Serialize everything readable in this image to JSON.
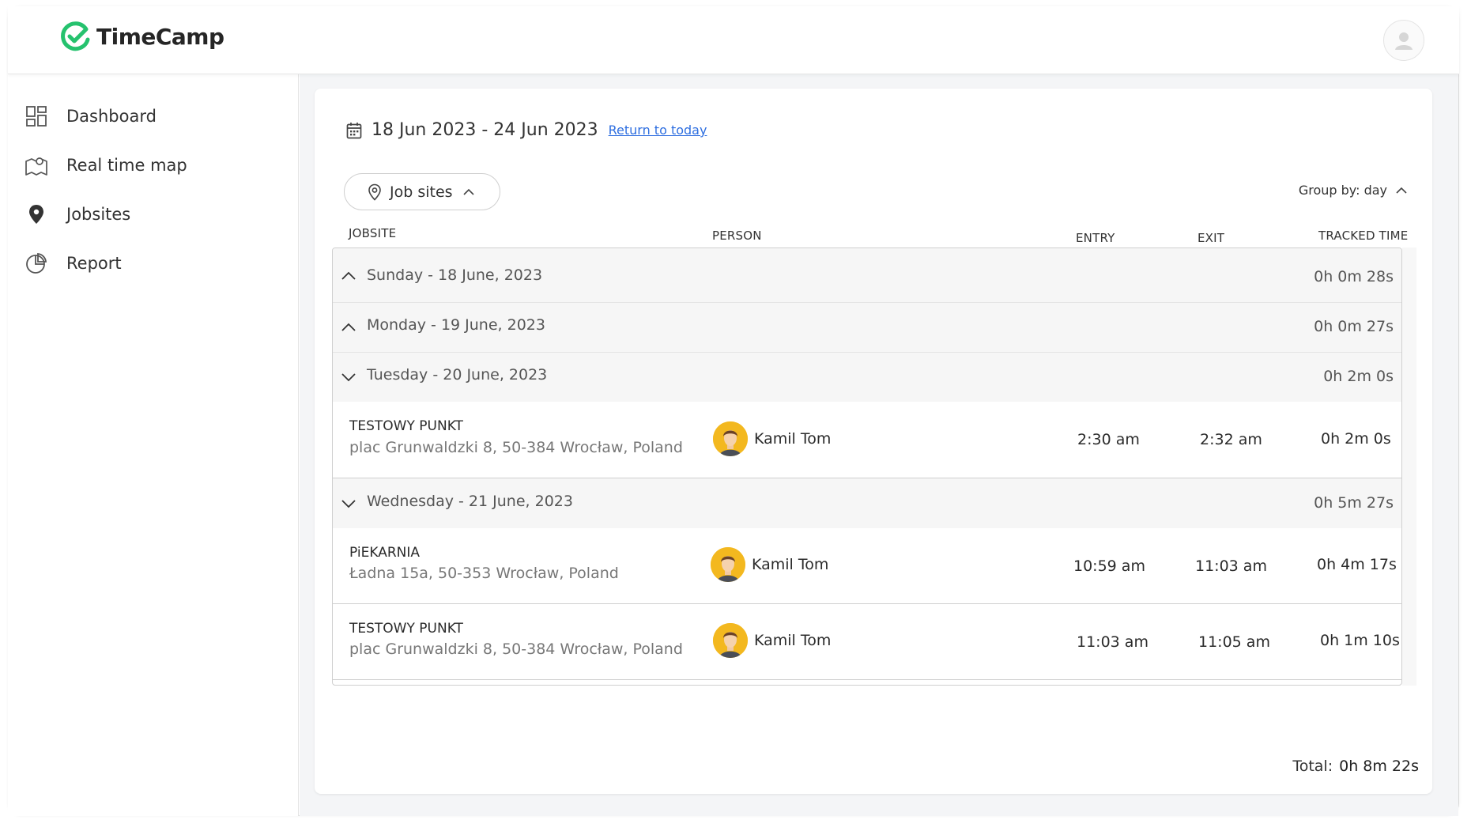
{
  "app": {
    "name": "TimeCamp",
    "brand_color": "#25c26e",
    "link_color": "#2f6fe0"
  },
  "sidebar": {
    "items": [
      {
        "label": "Dashboard",
        "icon": "dashboard-grid-icon"
      },
      {
        "label": "Real time map",
        "icon": "map-icon"
      },
      {
        "label": "Jobsites",
        "icon": "location-pin-icon"
      },
      {
        "label": "Report",
        "icon": "pie-chart-icon"
      }
    ]
  },
  "header": {
    "date_range": "18 Jun 2023 - 24 Jun 2023",
    "return_link": "Return to today",
    "filter_label": "Job sites",
    "group_by": "Group by: day"
  },
  "columns": {
    "jobsite": "JOBSITE",
    "person": "PERSON",
    "entry": "ENTRY",
    "exit": "EXIT",
    "tracked": "TRACKED TIME"
  },
  "days": [
    {
      "label": "Sunday - 18 June, 2023",
      "total": "0h 0m 28s",
      "expanded": false,
      "entries": []
    },
    {
      "label": "Monday - 19 June, 2023",
      "total": "0h 0m 27s",
      "expanded": false,
      "entries": []
    },
    {
      "label": "Tuesday - 20 June, 2023",
      "total": "0h 2m 0s",
      "expanded": true,
      "entries": [
        {
          "site": "TESTOWY PUNKT",
          "address": "plac Grunwaldzki 8, 50-384 Wrocław, Poland",
          "person": "Kamil Tom",
          "entry": "2:30 am",
          "exit": "2:32 am",
          "tracked": "0h 2m 0s"
        }
      ]
    },
    {
      "label": "Wednesday - 21 June, 2023",
      "total": "0h 5m 27s",
      "expanded": true,
      "entries": [
        {
          "site": "PiEKARNIA",
          "address": "Ładna 15a, 50-353 Wrocław, Poland",
          "person": "Kamil Tom",
          "entry": "10:59 am",
          "exit": "11:03 am",
          "tracked": "0h 4m 17s"
        },
        {
          "site": "TESTOWY PUNKT",
          "address": "plac Grunwaldzki 8, 50-384 Wrocław, Poland",
          "person": "Kamil Tom",
          "entry": "11:03 am",
          "exit": "11:05 am",
          "tracked": "0h 1m 10s"
        }
      ]
    }
  ],
  "footer": {
    "total_label": "Total:",
    "total_value": "0h 8m 22s"
  }
}
